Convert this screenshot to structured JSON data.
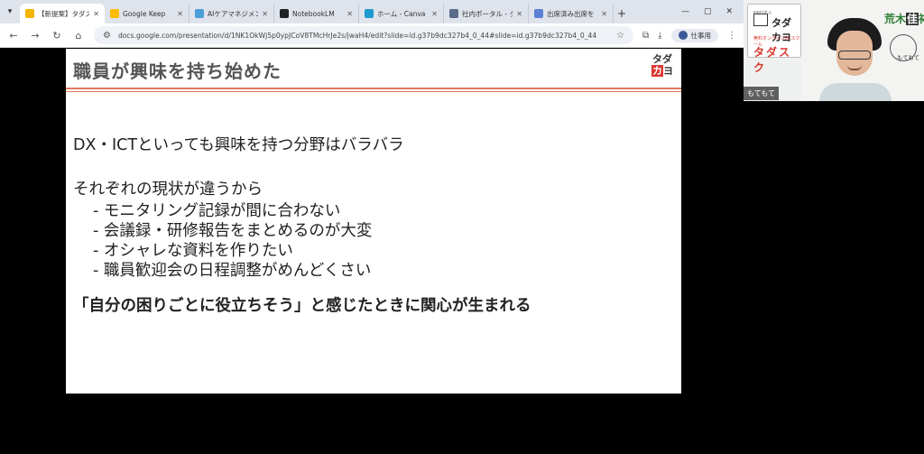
{
  "tabs": [
    {
      "label": "【新提案】タダスク",
      "color": "#f4b400",
      "active": true
    },
    {
      "label": "Google Keep",
      "color": "#fbbc04",
      "active": false
    },
    {
      "label": "AIケアマネジメント",
      "color": "#4a9fd8",
      "active": false
    },
    {
      "label": "NotebookLM",
      "color": "#202124",
      "active": false
    },
    {
      "label": "ホーム - Canva",
      "color": "#1d9bd1",
      "active": false
    },
    {
      "label": "社内ポータル - タ",
      "color": "#5b6b8c",
      "active": false
    },
    {
      "label": "出席済み出席を",
      "color": "#5b7fd4",
      "active": false
    }
  ],
  "toolbar": {
    "url": "docs.google.com/presentation/d/1NK1OkWj5p0ypJCoV8TMcHrJe2s/jwaH4/edit?slide=id.g37b9dc327b4_0_44#slide=id.g37b9dc327b4_0_44",
    "profile_label": "仕事用"
  },
  "slide": {
    "title": "職員が興味を持ち始めた",
    "logo_top": "タダ",
    "logo_ka": "カ",
    "logo_yo": "ヨ",
    "intro": "DX・ICTといっても興味を持つ分野はバラバラ",
    "reason_heading": "それぞれの現状が違うから",
    "bullets": [
      "- モニタリング記録が間に合わない",
      "- 会議録・研修報告をまとめるのが大変",
      "- オシャレな資料を作りたい",
      "- 職員歓迎会の日程調整がめんどくさい"
    ],
    "conclusion": "「自分の困りごとに役立ちそう」と感じたときに関心が生まれる"
  },
  "webcam": {
    "participant": "もてもて",
    "sign_small": "NPO法人",
    "sign_brand": "タダカヨ",
    "sign_school": "無料オンラインPCスクール",
    "sign_name": "タダスク",
    "nameplate_a": "荒木",
    "nameplate_hl": "佳",
    "nameplate_b": "祐",
    "nameplate_sub": "もてもて"
  }
}
